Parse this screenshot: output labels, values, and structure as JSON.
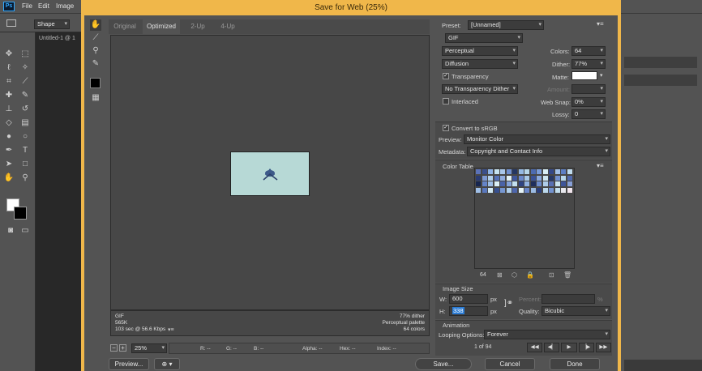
{
  "app": {
    "logo": "Ps"
  },
  "menu": [
    "File",
    "Edit",
    "Image"
  ],
  "options_bar": {
    "shape_select": "Shape"
  },
  "document_tab": "Untitled-1 @ 1",
  "dialog": {
    "title": "Save for Web (25%)",
    "tabs": [
      "Original",
      "Optimized",
      "2-Up",
      "4-Up"
    ],
    "active_tab": "Optimized",
    "info_left": [
      "GIF",
      "565K",
      "103 sec @ 56.6 Kbps"
    ],
    "info_right": [
      "77% dither",
      "Perceptual palette",
      "64 colors"
    ],
    "zoom": "25%",
    "readouts": [
      "R: --",
      "G: --",
      "B: --",
      "Alpha: --",
      "Hex: --",
      "Index: --"
    ],
    "buttons": {
      "preview": "Preview...",
      "save": "Save...",
      "cancel": "Cancel",
      "done": "Done"
    }
  },
  "settings": {
    "preset_label": "Preset:",
    "preset_value": "[Unnamed]",
    "format": "GIF",
    "reduction": "Perceptual",
    "dither_algo": "Diffusion",
    "colors_label": "Colors:",
    "colors_value": "64",
    "dither_label": "Dither:",
    "dither_value": "77%",
    "transparency_label": "Transparency",
    "transparency_checked": true,
    "matte_label": "Matte:",
    "trans_dither": "No Transparency Dither",
    "amount_label": "Amount:",
    "interlaced_label": "Interlaced",
    "interlaced_checked": false,
    "websnap_label": "Web Snap:",
    "websnap_value": "0%",
    "lossy_label": "Lossy:",
    "lossy_value": "0",
    "convert_srgb_label": "Convert to sRGB",
    "convert_srgb_checked": true,
    "preview_label": "Preview:",
    "preview_value": "Monitor Color",
    "metadata_label": "Metadata:",
    "metadata_value": "Copyright and Contact Info"
  },
  "color_table": {
    "title": "Color Table",
    "count": "64",
    "swatches": [
      "#5b72b8",
      "#3b4f8c",
      "#8fb3e6",
      "#c7e3f0",
      "#a9c7ea",
      "#6f8fd0",
      "#243663",
      "#95b9e3",
      "#b6d6e9",
      "#4d6bb0",
      "#7a9cd8",
      "#d8eef4",
      "#34498a",
      "#a2c1ea",
      "#5e7fc4",
      "#c0dcee",
      "#2a3b72",
      "#7e9ad4",
      "#b2d0ec",
      "#5570b5",
      "#90acdf",
      "#e1f1f6",
      "#40579c",
      "#6a88cb",
      "#a8c9e8",
      "#3a5296",
      "#8aa8dc",
      "#cde6f1",
      "#263867",
      "#7190d0",
      "#b8d7ea",
      "#5068ac",
      "#16254f",
      "#6584c8",
      "#9dbde6",
      "#dbeff5",
      "#4a63a8",
      "#83a2da",
      "#c4e0ef",
      "#2f4483",
      "#92b2e2",
      "#1e2e5d",
      "#6c8bcc",
      "#aecde9",
      "#586fb2",
      "#c9e3f0",
      "#3f5599",
      "#879fd6",
      "#a0bfe7",
      "#5a78bd",
      "#d1e8f2",
      "#37508f",
      "#7797d2",
      "#b0cfeb",
      "#4e66ac",
      "#e5f3f7",
      "#6986c9",
      "#9bbbe4",
      "#2b3f7b",
      "#bcd9ec",
      "#7493cf",
      "#c3dfee",
      "#e8e8ee",
      "#f2e6ee"
    ]
  },
  "image_size": {
    "title": "Image Size",
    "w_label": "W:",
    "w_value": "600",
    "w_unit": "px",
    "h_label": "H:",
    "h_value": "338",
    "h_unit": "px",
    "percent_label": "Percent:",
    "percent_unit": "%",
    "quality_label": "Quality:",
    "quality_value": "Bicubic"
  },
  "animation": {
    "title": "Animation",
    "looping_label": "Looping Options:",
    "looping_value": "Forever",
    "frame": "1 of 94"
  }
}
